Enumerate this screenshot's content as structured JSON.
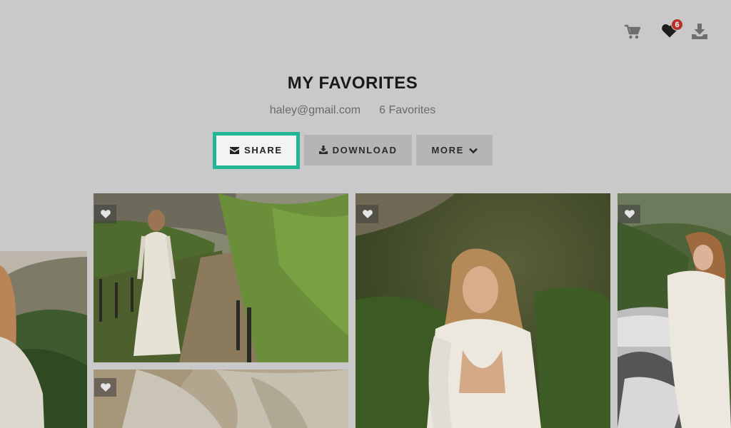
{
  "header": {
    "title": "MY FAVORITES",
    "email": "haley@gmail.com",
    "favorites_count": "6 Favorites",
    "badge_count": "6"
  },
  "icons": {
    "cart": "cart-icon",
    "favorites": "heart-icon",
    "download": "download-icon"
  },
  "actions": {
    "share_label": "SHARE",
    "download_label": "DOWNLOAD",
    "more_label": "MORE"
  },
  "colors": {
    "accent_highlight": "#22b596",
    "badge": "#b7312a",
    "overlay_background": "#c9c9c9"
  },
  "gallery": {
    "photos": [
      {
        "scene": "bride-in-vineyard-row",
        "favorited": true
      },
      {
        "scene": "bride-back-lace-dress",
        "favorited": true
      },
      {
        "scene": "bride-by-vintage-car",
        "favorited": true
      },
      {
        "scene": "lace-dress-closeup",
        "favorited": true
      },
      {
        "scene": "bride-hills-partial",
        "favorited": true
      }
    ]
  }
}
